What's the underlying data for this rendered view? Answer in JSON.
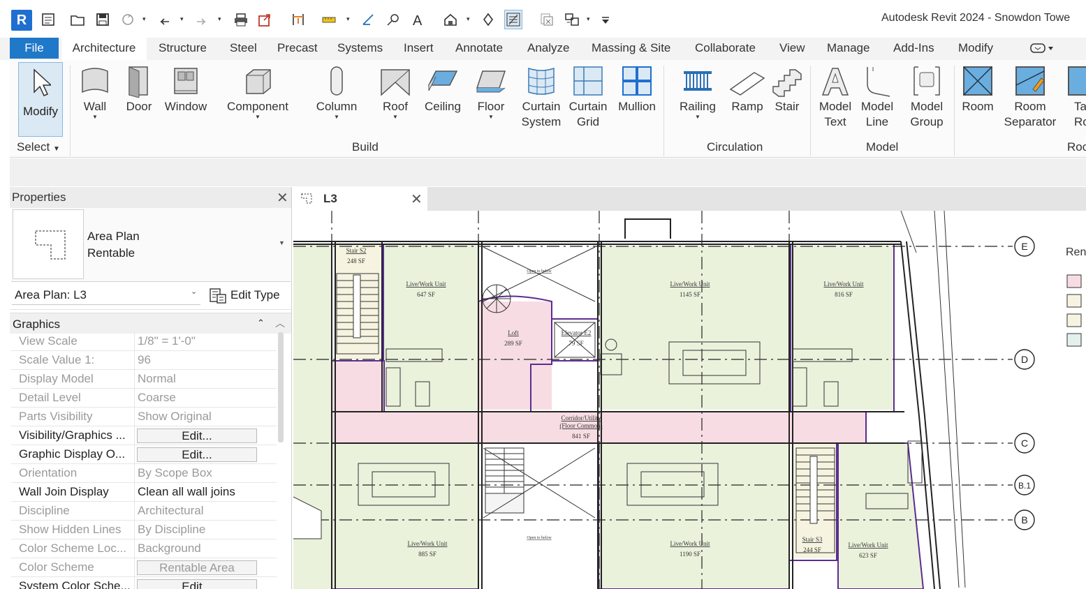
{
  "app": {
    "logo_letter": "R",
    "title": "Autodesk Revit 2024 - Snowdon Towe"
  },
  "quick_access": [
    {
      "icon": "open-icon"
    },
    {
      "icon": "save-icon"
    },
    {
      "icon": "sync-icon"
    },
    {
      "icon": "undo-icon"
    },
    {
      "icon": "redo-icon"
    },
    {
      "icon": "print-icon"
    },
    {
      "icon": "export-icon"
    },
    {
      "icon": "align-dimension-icon"
    },
    {
      "icon": "measure-icon"
    },
    {
      "icon": "tag-icon"
    },
    {
      "icon": "text-icon"
    },
    {
      "icon": "3d-view-icon"
    },
    {
      "icon": "section-icon"
    },
    {
      "icon": "thin-lines-icon"
    },
    {
      "icon": "close-hidden-icon"
    },
    {
      "icon": "switch-windows-icon"
    },
    {
      "icon": "customize-icon"
    }
  ],
  "tabs": {
    "file": "File",
    "items": [
      "Architecture",
      "Structure",
      "Steel",
      "Precast",
      "Systems",
      "Insert",
      "Annotate",
      "Analyze",
      "Massing & Site",
      "Collaborate",
      "View",
      "Manage",
      "Add-Ins",
      "Modify"
    ],
    "active": "Architecture"
  },
  "ribbon": {
    "modify": "Modify",
    "select_panel": "Select",
    "build": {
      "label": "Build",
      "tools": [
        "Wall",
        "Door",
        "Window",
        "Component",
        "Column",
        "Roof",
        "Ceiling",
        "Floor",
        "Curtain System",
        "Curtain Grid",
        "Mullion"
      ]
    },
    "circulation": {
      "label": "Circulation",
      "tools": [
        "Railing",
        "Ramp",
        "Stair"
      ]
    },
    "model": {
      "label": "Model",
      "tools": [
        "Model Text",
        "Model Line",
        "Model Group"
      ]
    },
    "room_area": {
      "label": "Roo",
      "tools": [
        "Room",
        "Room Separator",
        "Ta Roo"
      ]
    }
  },
  "properties": {
    "title": "Properties",
    "type_name_line1": "Area Plan",
    "type_name_line2": "Rentable",
    "instance": "Area Plan: L3",
    "edit_type": "Edit Type",
    "section": "Graphics",
    "rows": [
      {
        "name": "View Scale",
        "value": "1/8\" = 1'-0\"",
        "readonly": true
      },
      {
        "name": "Scale Value    1:",
        "value": "96",
        "readonly": true
      },
      {
        "name": "Display Model",
        "value": "Normal",
        "readonly": true
      },
      {
        "name": "Detail Level",
        "value": "Coarse",
        "readonly": true
      },
      {
        "name": "Parts Visibility",
        "value": "Show Original",
        "readonly": true
      },
      {
        "name": "Visibility/Graphics ...",
        "button": "Edit...",
        "readonly": false
      },
      {
        "name": "Graphic Display O...",
        "button": "Edit...",
        "readonly": false
      },
      {
        "name": "Orientation",
        "value": "By Scope Box",
        "readonly": true
      },
      {
        "name": "Wall Join Display",
        "value": "Clean all wall joins",
        "readonly": false
      },
      {
        "name": "Discipline",
        "value": "Architectural",
        "readonly": true
      },
      {
        "name": "Show Hidden Lines",
        "value": "By Discipline",
        "readonly": true
      },
      {
        "name": "Color Scheme Loc...",
        "value": "Background",
        "readonly": true
      },
      {
        "name": "Color Scheme",
        "button": "Rentable Area",
        "readonly": true
      },
      {
        "name": "System Color Sche...",
        "button": "Edit...",
        "readonly": false
      }
    ]
  },
  "view_tab": {
    "label": "L3"
  },
  "drawing": {
    "grids": [
      "E",
      "D",
      "C",
      "B.1",
      "B"
    ],
    "legend_label": "Ren",
    "rooms": [
      {
        "name": "Stair S2",
        "area": "248 SF"
      },
      {
        "name": "Live/Work Unit",
        "area": "647 SF"
      },
      {
        "name": "Open to below",
        "area": ""
      },
      {
        "name": "Loft",
        "area": "289 SF"
      },
      {
        "name": "Elevator E2",
        "area": "79 SF"
      },
      {
        "name": "Live/Work Unit",
        "area": "1145 SF"
      },
      {
        "name": "Live/Work Unit",
        "area": "816 SF"
      },
      {
        "name": "Corridor/Utility (Floor Common)",
        "area": "841 SF"
      },
      {
        "name": "Live/Work Unit",
        "area": "885 SF"
      },
      {
        "name": "Open to below",
        "area": ""
      },
      {
        "name": "Live/Work Unit",
        "area": "1190 SF"
      },
      {
        "name": "Stair S3",
        "area": "244 SF"
      },
      {
        "name": "Live/Work Unit",
        "area": "623 SF"
      }
    ],
    "colors": {
      "unit_fill": "#eaf2dc",
      "corridor_fill": "#f7dde3",
      "stair_fill": "#f6f4e0",
      "area_boundary": "#5b2d91",
      "grid_line": "#222222"
    }
  }
}
